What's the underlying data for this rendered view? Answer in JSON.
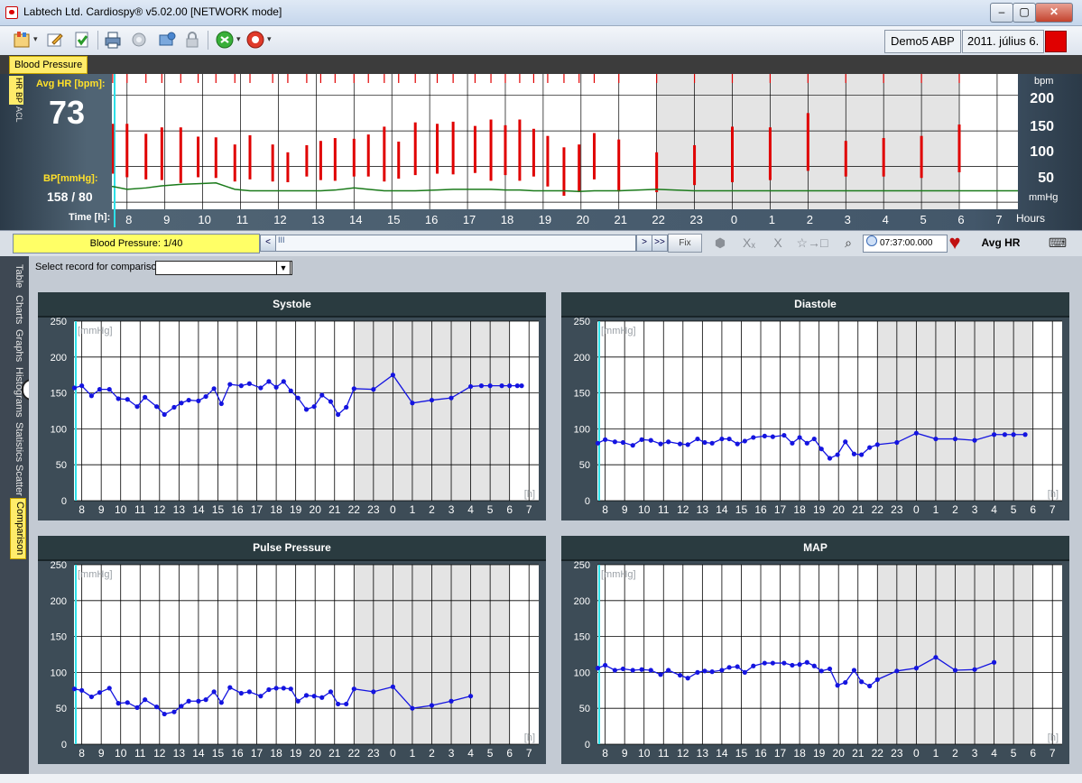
{
  "window": {
    "title": "Labtech Ltd. Cardiospy® v5.02.00 [NETWORK mode]",
    "controls": [
      "–",
      "▢",
      "✕"
    ]
  },
  "toolbar": {
    "icons": [
      "cardiospy-menu-icon",
      "edit-icon",
      "download-icon",
      "print-icon",
      "gear-icon",
      "image-icon",
      "lock-icon",
      "refresh-icon",
      "help-icon"
    ],
    "patient": "Demo5 ABP",
    "date": "2011. július 6.",
    "status_color": "#e00000"
  },
  "tabs": {
    "active": "Blood Pressure"
  },
  "overview": {
    "side_tabs": [
      "HR",
      "BP",
      "ACL"
    ],
    "avg_hr_label": "Avg HR [bpm]:",
    "avg_hr_value": "73",
    "bp_label": "BP[mmHg]:",
    "bp_value": "158 / 80",
    "time_label": "Time [h]:",
    "right_unit_top": "bpm",
    "right_unit_bottom": "mmHg",
    "right_ticks": [
      "200",
      "150",
      "100",
      "50"
    ],
    "hours_label": "Hours",
    "hour_labels": [
      "8",
      "9",
      "10",
      "11",
      "12",
      "13",
      "14",
      "15",
      "16",
      "17",
      "18",
      "19",
      "20",
      "21",
      "22",
      "23",
      "0",
      "1",
      "2",
      "3",
      "4",
      "5",
      "6",
      "7"
    ],
    "night_start_hour": 22,
    "night_end_hour": 6
  },
  "nav": {
    "record_label": "Blood Pressure: 1/40",
    "scroll_left": "<",
    "scroll_thumb": "III",
    "scroll_right": ">",
    "scroll_end": ">>",
    "fix": "Fix",
    "icons": [
      "hide-icon",
      "x-subscript-icon",
      "x-icon",
      "export-icon",
      "zoom-icon"
    ],
    "time": "07:37:00.000",
    "avg_hr_button": "Avg HR",
    "keyboard_icon": "keyboard-mouse-icon"
  },
  "left_tabs": [
    "Table",
    "Charts",
    "Graphs",
    "Histograms",
    "Statistics",
    "Scatter",
    "Comparison"
  ],
  "left_tabs_active": "Comparison",
  "collapse_icon": "<",
  "comparison": {
    "label": "Select record for comparison:",
    "value": ""
  },
  "chart_data": [
    {
      "type": "line",
      "title": "Systole",
      "ylabel": "[mmHg]",
      "xlabel": "[h]",
      "ylim": [
        0,
        250
      ],
      "yticks": [
        0,
        50,
        100,
        150,
        200,
        250
      ],
      "x_categories": [
        "8",
        "9",
        "10",
        "11",
        "12",
        "13",
        "14",
        "15",
        "16",
        "17",
        "18",
        "19",
        "20",
        "21",
        "22",
        "23",
        "0",
        "1",
        "2",
        "3",
        "4",
        "5",
        "6",
        "7"
      ],
      "night_range": [
        "22",
        "6"
      ],
      "x": [
        7.62,
        8.0,
        8.5,
        8.92,
        9.42,
        9.88,
        10.35,
        10.85,
        11.25,
        11.85,
        12.25,
        12.75,
        13.12,
        13.5,
        14.0,
        14.38,
        14.8,
        15.18,
        15.62,
        16.2,
        16.62,
        17.2,
        17.62,
        18.0,
        18.38,
        18.75,
        19.12,
        19.55,
        19.95,
        20.35,
        20.8,
        21.18,
        21.6,
        22.0,
        23.0,
        24.0,
        25.0,
        26.0,
        27.0,
        28.0,
        28.55,
        29.0,
        29.6,
        30.0,
        30.4,
        30.62
      ],
      "values": [
        157,
        160,
        146,
        155,
        155,
        142,
        141,
        131,
        144,
        131,
        120,
        130,
        136,
        140,
        139,
        145,
        156,
        135,
        162,
        160,
        163,
        157,
        166,
        158,
        166,
        153,
        143,
        127,
        131,
        147,
        138,
        120,
        130,
        156,
        155,
        175,
        136,
        140,
        143,
        159,
        160,
        160,
        160,
        160,
        160,
        160
      ]
    },
    {
      "type": "line",
      "title": "Diastole",
      "ylabel": "[mmHg]",
      "xlabel": "[h]",
      "ylim": [
        0,
        250
      ],
      "yticks": [
        0,
        50,
        100,
        150,
        200,
        250
      ],
      "x_categories": [
        "8",
        "9",
        "10",
        "11",
        "12",
        "13",
        "14",
        "15",
        "16",
        "17",
        "18",
        "19",
        "20",
        "21",
        "22",
        "23",
        "0",
        "1",
        "2",
        "3",
        "4",
        "5",
        "6",
        "7"
      ],
      "night_range": [
        "22",
        "6"
      ],
      "x": [
        7.62,
        8.0,
        8.5,
        8.92,
        9.42,
        9.88,
        10.35,
        10.85,
        11.25,
        11.85,
        12.25,
        12.75,
        13.12,
        13.5,
        14.0,
        14.38,
        14.8,
        15.18,
        15.62,
        16.2,
        16.62,
        17.2,
        17.62,
        18.0,
        18.38,
        18.75,
        19.12,
        19.55,
        19.95,
        20.35,
        20.8,
        21.18,
        21.6,
        22.0,
        23.0,
        24.0,
        25.0,
        26.0,
        27.0,
        28.0,
        28.55,
        29.0,
        29.6
      ],
      "values": [
        80,
        85,
        82,
        81,
        77,
        85,
        84,
        79,
        82,
        79,
        78,
        86,
        81,
        80,
        86,
        86,
        79,
        83,
        88,
        90,
        89,
        91,
        80,
        88,
        80,
        86,
        72,
        59,
        64,
        82,
        65,
        64,
        74,
        78,
        81,
        94,
        86,
        86,
        84,
        92,
        92,
        92,
        92
      ]
    },
    {
      "type": "line",
      "title": "Pulse Pressure",
      "ylabel": "[mmHg]",
      "xlabel": "[h]",
      "ylim": [
        0,
        250
      ],
      "yticks": [
        0,
        50,
        100,
        150,
        200,
        250
      ],
      "x_categories": [
        "8",
        "9",
        "10",
        "11",
        "12",
        "13",
        "14",
        "15",
        "16",
        "17",
        "18",
        "19",
        "20",
        "21",
        "22",
        "23",
        "0",
        "1",
        "2",
        "3",
        "4",
        "5",
        "6",
        "7"
      ],
      "night_range": [
        "22",
        "6"
      ],
      "x": [
        7.62,
        8.0,
        8.5,
        8.92,
        9.42,
        9.88,
        10.35,
        10.85,
        11.25,
        11.85,
        12.25,
        12.75,
        13.12,
        13.5,
        14.0,
        14.38,
        14.8,
        15.18,
        15.62,
        16.2,
        16.62,
        17.2,
        17.62,
        18.0,
        18.38,
        18.75,
        19.12,
        19.55,
        19.95,
        20.35,
        20.8,
        21.18,
        21.6,
        22.0,
        23.0,
        24.0,
        25.0,
        26.0,
        27.0,
        28.0
      ],
      "values": [
        77,
        75,
        66,
        72,
        78,
        57,
        58,
        51,
        62,
        52,
        42,
        45,
        53,
        60,
        60,
        62,
        73,
        58,
        79,
        71,
        73,
        67,
        76,
        78,
        78,
        77,
        60,
        68,
        67,
        65,
        73,
        56,
        56,
        77,
        73,
        80,
        50,
        54,
        60,
        67
      ]
    },
    {
      "type": "line",
      "title": "MAP",
      "ylabel": "[mmHg]",
      "xlabel": "[h]",
      "ylim": [
        0,
        250
      ],
      "yticks": [
        0,
        50,
        100,
        150,
        200,
        250
      ],
      "x_categories": [
        "8",
        "9",
        "10",
        "11",
        "12",
        "13",
        "14",
        "15",
        "16",
        "17",
        "18",
        "19",
        "20",
        "21",
        "22",
        "23",
        "0",
        "1",
        "2",
        "3",
        "4",
        "5",
        "6",
        "7"
      ],
      "night_range": [
        "22",
        "6"
      ],
      "x": [
        7.62,
        8.0,
        8.5,
        8.92,
        9.42,
        9.88,
        10.35,
        10.85,
        11.25,
        11.85,
        12.25,
        12.75,
        13.12,
        13.5,
        14.0,
        14.38,
        14.8,
        15.18,
        15.62,
        16.2,
        16.62,
        17.2,
        17.62,
        18.0,
        18.38,
        18.75,
        19.12,
        19.55,
        19.95,
        20.35,
        20.8,
        21.18,
        21.6,
        22.0,
        23.0,
        24.0,
        25.0,
        26.0,
        27.0,
        28.0
      ],
      "values": [
        106,
        110,
        103,
        105,
        103,
        104,
        103,
        97,
        103,
        96,
        92,
        100,
        102,
        101,
        103,
        107,
        108,
        100,
        109,
        113,
        113,
        113,
        110,
        111,
        114,
        109,
        102,
        105,
        82,
        86,
        103,
        87,
        81,
        90,
        102,
        106,
        121,
        103,
        104,
        114
      ]
    },
    {
      "type": "bar",
      "title": "",
      "ylabel": "bpm / mmHg",
      "xlabel": "Time [h]",
      "ylim": [
        40,
        230
      ],
      "x": [
        7.62,
        8.0,
        8.5,
        8.92,
        9.42,
        9.88,
        10.35,
        10.85,
        11.25,
        11.85,
        12.25,
        12.75,
        13.12,
        13.5,
        14.0,
        14.38,
        14.8,
        15.18,
        15.62,
        16.2,
        16.62,
        17.2,
        17.62,
        18.0,
        18.38,
        18.75,
        19.12,
        19.55,
        19.95,
        20.35,
        21.0,
        22.0,
        23.0,
        24.0,
        25.0,
        26.0,
        27.0,
        28.0,
        29.0,
        30.0
      ],
      "systole": [
        160,
        160,
        146,
        155,
        155,
        142,
        141,
        131,
        144,
        131,
        120,
        130,
        136,
        140,
        139,
        145,
        156,
        135,
        162,
        160,
        163,
        157,
        166,
        158,
        166,
        153,
        143,
        127,
        131,
        147,
        138,
        120,
        130,
        156,
        155,
        175,
        136,
        140,
        143,
        159
      ],
      "diastole": [
        90,
        85,
        82,
        81,
        77,
        85,
        84,
        79,
        82,
        79,
        78,
        86,
        81,
        80,
        86,
        86,
        79,
        83,
        88,
        90,
        89,
        91,
        80,
        88,
        80,
        86,
        72,
        59,
        64,
        82,
        65,
        64,
        74,
        78,
        81,
        94,
        86,
        86,
        84,
        92
      ],
      "hr_line": [
        72,
        68,
        70,
        73,
        75,
        76,
        77,
        68,
        66,
        66,
        66,
        66,
        66,
        67,
        70,
        68,
        66,
        66,
        66,
        67,
        68,
        68,
        68,
        67,
        67,
        66,
        66,
        66,
        65,
        66,
        66,
        68,
        66,
        66,
        66,
        66,
        66,
        66,
        66,
        66
      ]
    }
  ]
}
